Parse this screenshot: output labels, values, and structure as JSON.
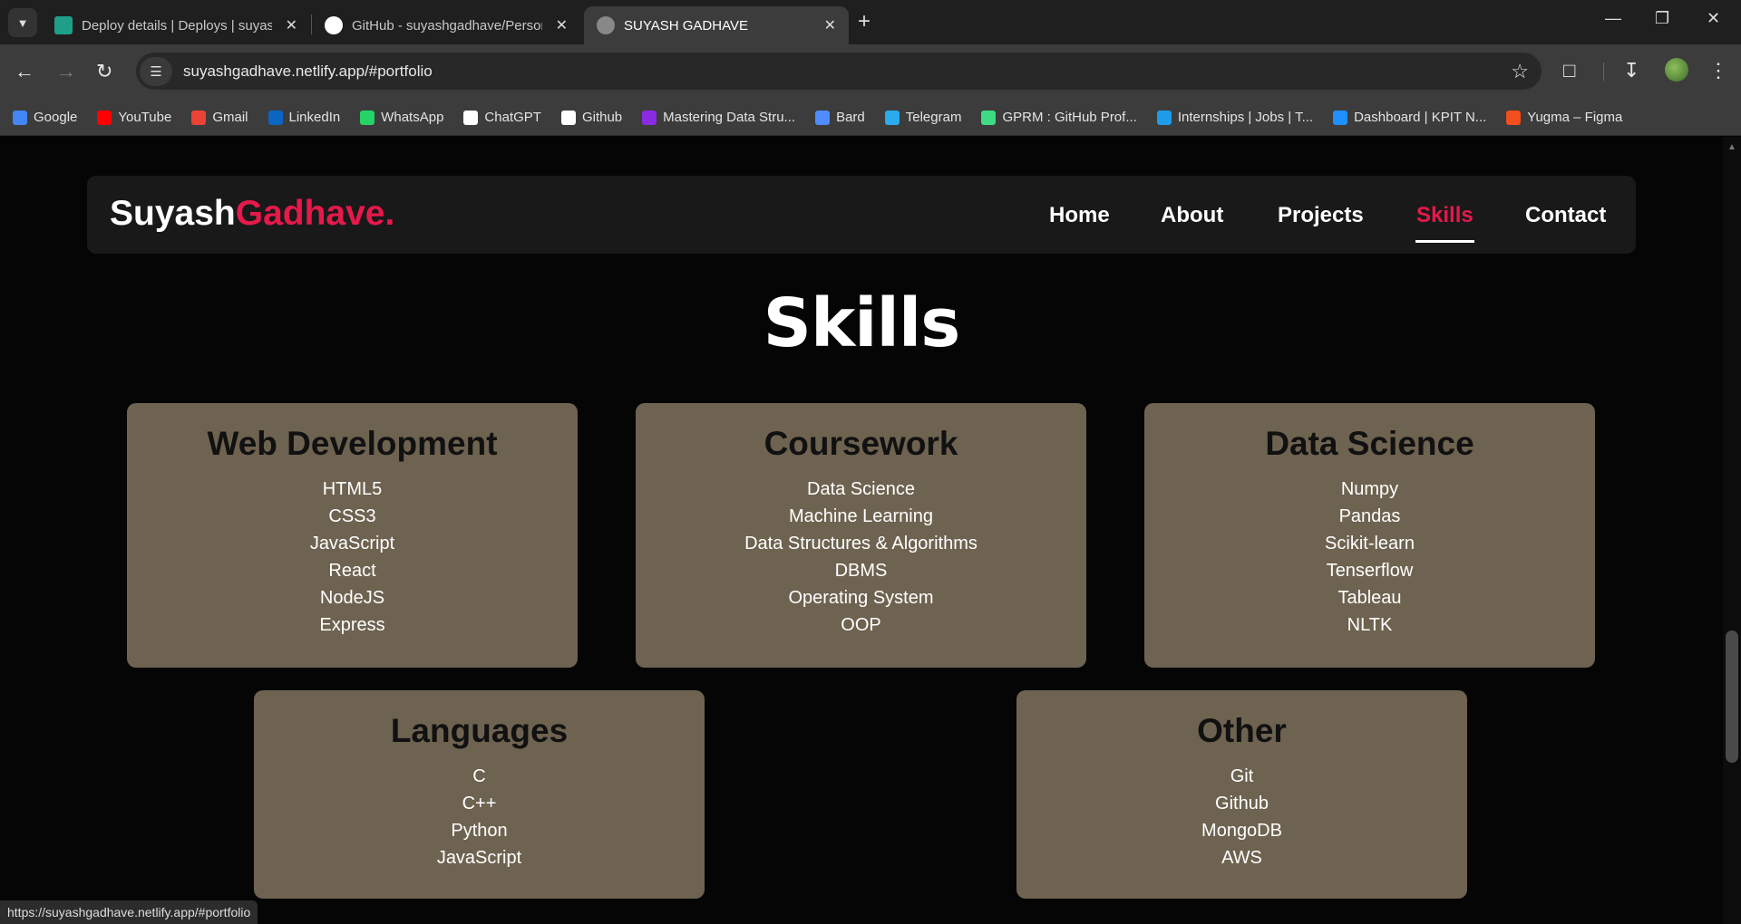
{
  "browser": {
    "tabs": [
      {
        "title": "Deploy details | Deploys | suyash",
        "active": false
      },
      {
        "title": "GitHub - suyashgadhave/Personal",
        "active": false
      },
      {
        "title": "SUYASH GADHAVE",
        "active": true
      }
    ],
    "url": "suyashgadhave.netlify.app/#portfolio",
    "bookmarks": [
      {
        "label": "Google",
        "icon": "google-icon",
        "color": "#4285f4"
      },
      {
        "label": "YouTube",
        "icon": "youtube-icon",
        "color": "#ff0000"
      },
      {
        "label": "Gmail",
        "icon": "gmail-icon",
        "color": "#ea4335"
      },
      {
        "label": "LinkedIn",
        "icon": "linkedin-icon",
        "color": "#0a66c2"
      },
      {
        "label": "WhatsApp",
        "icon": "whatsapp-icon",
        "color": "#25d366"
      },
      {
        "label": "ChatGPT",
        "icon": "chatgpt-icon",
        "color": "#ffffff"
      },
      {
        "label": "Github",
        "icon": "github-icon",
        "color": "#ffffff"
      },
      {
        "label": "Mastering Data Stru...",
        "icon": "course-icon",
        "color": "#8a2be2"
      },
      {
        "label": "Bard",
        "icon": "bard-icon",
        "color": "#4e8cff"
      },
      {
        "label": "Telegram",
        "icon": "telegram-icon",
        "color": "#2aabee"
      },
      {
        "label": "GPRM : GitHub Prof...",
        "icon": "gprm-icon",
        "color": "#3ddc84"
      },
      {
        "label": "Internships | Jobs | T...",
        "icon": "internshala-icon",
        "color": "#1e9be9"
      },
      {
        "label": "Dashboard | KPIT N...",
        "icon": "kpit-icon",
        "color": "#1e90ff"
      },
      {
        "label": "Yugma – Figma",
        "icon": "figma-icon",
        "color": "#f24e1e"
      }
    ],
    "status_url": "https://suyashgadhave.netlify.app/#portfolio"
  },
  "site": {
    "logo_first": "Suyash",
    "logo_second": "Gadhave.",
    "nav": [
      "Home",
      "About",
      "Projects",
      "Skills",
      "Contact"
    ],
    "active_nav": "Skills",
    "accent_color": "#e6194b",
    "card_color": "#6e6350"
  },
  "skills": {
    "title": "Skills",
    "cards": [
      {
        "heading": "Web Development",
        "items": [
          "HTML5",
          "CSS3",
          "JavaScript",
          "React",
          "NodeJS",
          "Express"
        ]
      },
      {
        "heading": "Coursework",
        "items": [
          "Data Science",
          "Machine Learning",
          "Data Structures & Algorithms",
          "DBMS",
          "Operating System",
          "OOP"
        ]
      },
      {
        "heading": "Data Science",
        "items": [
          "Numpy",
          "Pandas",
          "Scikit-learn",
          "Tenserflow",
          "Tableau",
          "NLTK"
        ]
      },
      {
        "heading": "Languages",
        "items": [
          "C",
          "C++",
          "Python",
          "JavaScript"
        ]
      },
      {
        "heading": "Other",
        "items": [
          "Git",
          "Github",
          "MongoDB",
          "AWS"
        ]
      }
    ]
  }
}
